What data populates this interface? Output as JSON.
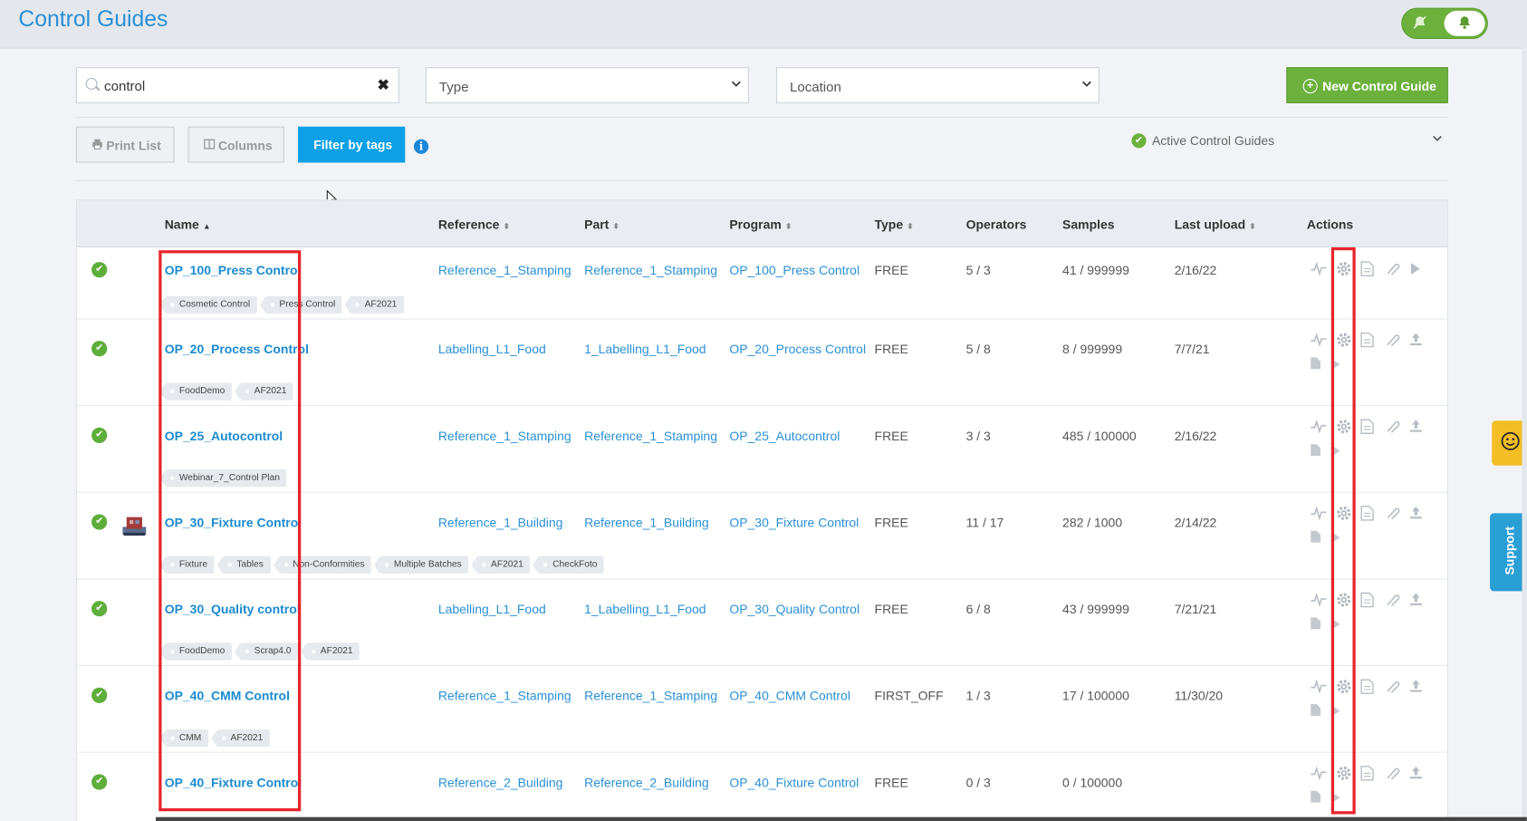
{
  "header": {
    "title": "Control Guides",
    "notifications_toggle": {
      "state": "on",
      "off_icon": "bell-slash-icon",
      "on_icon": "bell-icon"
    }
  },
  "filters": {
    "search_value": "control",
    "clear_icon": "✖",
    "type_placeholder": "Type",
    "location_placeholder": "Location",
    "new_button": "New Control Guide"
  },
  "toolbar": {
    "print_label": "Print List",
    "columns_label": "Columns",
    "filter_tags_label": "Filter by tags",
    "active_filter_label": "Active Control Guides"
  },
  "colors": {
    "accent_blue": "#2b8fd6",
    "green": "#6bb13c",
    "highlight_red": "#e8232a"
  },
  "table": {
    "columns": {
      "name": "Name",
      "reference": "Reference",
      "part": "Part",
      "program": "Program",
      "type": "Type",
      "operators": "Operators",
      "samples": "Samples",
      "last_upload": "Last upload",
      "actions": "Actions"
    },
    "rows": [
      {
        "name": "OP_100_Press Control",
        "reference": "Reference_1_Stamping",
        "part": "Reference_1_Stamping",
        "program": "OP_100_Press Control",
        "type": "FREE",
        "operators": "5 / 3",
        "samples": "41 / 999999",
        "last_upload": "2/16/22",
        "tags": [
          "Cosmetic Control",
          "Press Control",
          "AF2021"
        ]
      },
      {
        "name": "OP_20_Process Control",
        "reference": "Labelling_L1_Food",
        "part": "1_Labelling_L1_Food",
        "program": "OP_20_Process Control",
        "type": "FREE",
        "operators": "5 / 8",
        "samples": "8 / 999999",
        "last_upload": "7/7/21",
        "tags": [
          "FoodDemo",
          "AF2021"
        ]
      },
      {
        "name": "OP_25_Autocontrol",
        "reference": "Reference_1_Stamping",
        "part": "Reference_1_Stamping",
        "program": "OP_25_Autocontrol",
        "type": "FREE",
        "operators": "3 / 3",
        "samples": "485 / 100000",
        "last_upload": "2/16/22",
        "tags": [
          "Webinar_7_Control Plan"
        ]
      },
      {
        "name": "OP_30_Fixture Control",
        "reference": "Reference_1_Building",
        "part": "Reference_1_Building",
        "program": "OP_30_Fixture Control",
        "type": "FREE",
        "operators": "11 / 17",
        "samples": "282 / 1000",
        "last_upload": "2/14/22",
        "tags": [
          "Fixture",
          "Tables",
          "Non-Conformities",
          "Multiple Batches",
          "AF2021",
          "CheckFoto"
        ]
      },
      {
        "name": "OP_30_Quality control",
        "reference": "Labelling_L1_Food",
        "part": "1_Labelling_L1_Food",
        "program": "OP_30_Quality Control",
        "type": "FREE",
        "operators": "6 / 8",
        "samples": "43 / 999999",
        "last_upload": "7/21/21",
        "tags": [
          "FoodDemo",
          "Scrap4.0",
          "AF2021"
        ]
      },
      {
        "name": "OP_40_CMM Control",
        "reference": "Reference_1_Stamping",
        "part": "Reference_1_Stamping",
        "program": "OP_40_CMM Control",
        "type": "FIRST_OFF",
        "operators": "1 / 3",
        "samples": "17 / 100000",
        "last_upload": "11/30/20",
        "tags": [
          "CMM",
          "AF2021"
        ]
      },
      {
        "name": "OP_40_Fixture Control",
        "reference": "Reference_2_Building",
        "part": "Reference_2_Building",
        "program": "OP_40_Fixture Control",
        "type": "FREE",
        "operators": "0 / 3",
        "samples": "0 / 100000",
        "last_upload": "",
        "tags": []
      }
    ]
  },
  "side_tabs": {
    "feedback_icon": "smiley-icon",
    "support_label": "Support"
  }
}
